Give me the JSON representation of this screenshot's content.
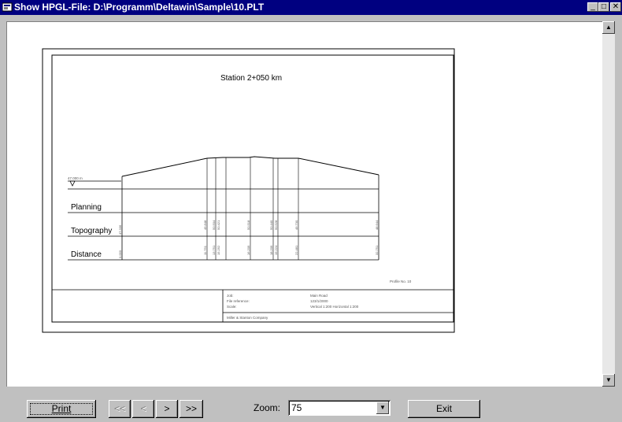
{
  "window": {
    "title": "Show HPGL-File: D:\\Programm\\Deltawin\\Sample\\10.PLT",
    "minimize_glyph": "_",
    "maximize_glyph": "□",
    "close_glyph": "✕"
  },
  "drawing": {
    "title": "Station 2+050 km",
    "elevation": "47.000 m",
    "rows": [
      "Planning",
      "Topography",
      "Distance"
    ],
    "topography_values": [
      "47.336",
      "49.848",
      "50.504",
      "50.421",
      "50.518",
      "50.440",
      "50.528",
      "49.730",
      "48.644"
    ],
    "distance_values": [
      "0.000",
      "11.751",
      "13.751",
      "15.252",
      "16.209",
      "18.209",
      "19.224",
      "22.481",
      "32.751"
    ],
    "profile_no": "Profile No. 10",
    "titleblock": {
      "job_label": "Job:",
      "job_value": "Main Road",
      "fileref_label": "File reference:",
      "fileref_value": "123/1/2000",
      "scale_label": "Scale:",
      "scale_value": "Vertical 1:200  Horizontal 1:200",
      "company": "Miller & Stanton Company"
    }
  },
  "toolbar": {
    "print_label": "Print",
    "first_label": "<<",
    "prev_label": "<",
    "next_label": ">",
    "last_label": ">>",
    "zoom_label": "Zoom:",
    "zoom_value": "75",
    "exit_label": "Exit"
  }
}
